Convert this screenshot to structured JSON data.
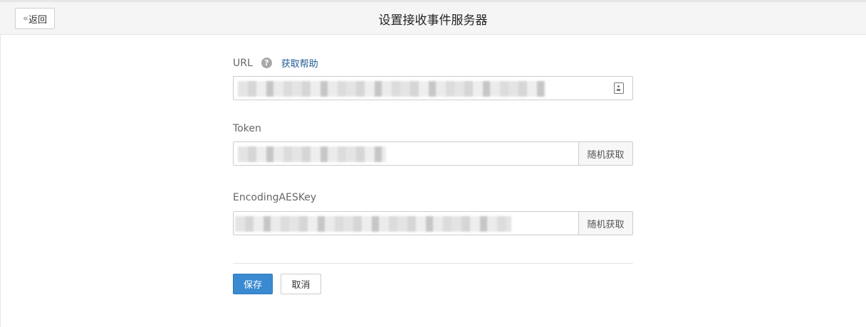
{
  "header": {
    "back_label": "返回",
    "back_icon": "chevron-double-left-icon",
    "title": "设置接收事件服务器"
  },
  "form": {
    "url": {
      "label": "URL",
      "help_icon": "question-icon",
      "help_link": "获取帮助",
      "trailing_icon": "contact-card-icon"
    },
    "token": {
      "label": "Token",
      "random_button": "随机获取"
    },
    "aes_key": {
      "label": "EncodingAESKey",
      "random_button": "随机获取"
    },
    "save_button": "保存",
    "cancel_button": "取消"
  },
  "colors": {
    "primary": "#3a8ad2",
    "link": "#1f5b92",
    "header_bg": "#f5f5f5"
  }
}
